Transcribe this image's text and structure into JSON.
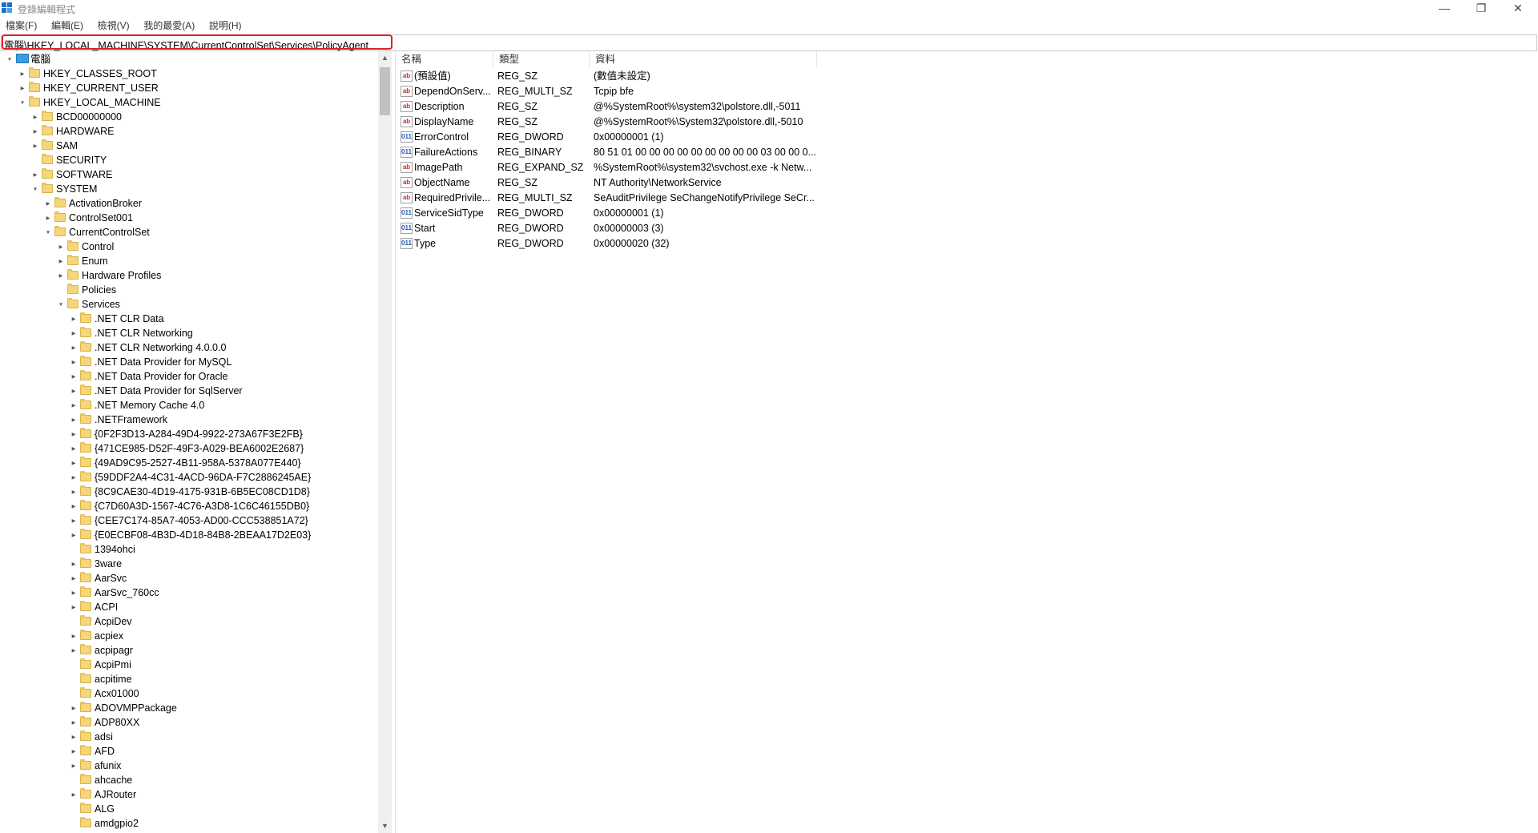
{
  "window": {
    "title": "登錄編輯程式",
    "minimize": "—",
    "maximize": "❐",
    "close": "✕"
  },
  "menu": [
    "檔案(F)",
    "編輯(E)",
    "檢視(V)",
    "我的最愛(A)",
    "說明(H)"
  ],
  "address": "電腦\\HKEY_LOCAL_MACHINE\\SYSTEM\\CurrentControlSet\\Services\\PolicyAgent",
  "tree": [
    {
      "label": "電腦",
      "level": 0,
      "state": "open",
      "icon": "computer-icon"
    },
    {
      "label": "HKEY_CLASSES_ROOT",
      "level": 1,
      "state": "closed"
    },
    {
      "label": "HKEY_CURRENT_USER",
      "level": 1,
      "state": "closed"
    },
    {
      "label": "HKEY_LOCAL_MACHINE",
      "level": 1,
      "state": "open"
    },
    {
      "label": "BCD00000000",
      "level": 2,
      "state": "closed"
    },
    {
      "label": "HARDWARE",
      "level": 2,
      "state": "closed"
    },
    {
      "label": "SAM",
      "level": 2,
      "state": "closed"
    },
    {
      "label": "SECURITY",
      "level": 2,
      "state": "none"
    },
    {
      "label": "SOFTWARE",
      "level": 2,
      "state": "closed"
    },
    {
      "label": "SYSTEM",
      "level": 2,
      "state": "open"
    },
    {
      "label": "ActivationBroker",
      "level": 3,
      "state": "closed"
    },
    {
      "label": "ControlSet001",
      "level": 3,
      "state": "closed"
    },
    {
      "label": "CurrentControlSet",
      "level": 3,
      "state": "open"
    },
    {
      "label": "Control",
      "level": 4,
      "state": "closed"
    },
    {
      "label": "Enum",
      "level": 4,
      "state": "closed"
    },
    {
      "label": "Hardware Profiles",
      "level": 4,
      "state": "closed"
    },
    {
      "label": "Policies",
      "level": 4,
      "state": "none"
    },
    {
      "label": "Services",
      "level": 4,
      "state": "open"
    },
    {
      "label": ".NET CLR Data",
      "level": 5,
      "state": "closed"
    },
    {
      "label": ".NET CLR Networking",
      "level": 5,
      "state": "closed"
    },
    {
      "label": ".NET CLR Networking 4.0.0.0",
      "level": 5,
      "state": "closed"
    },
    {
      "label": ".NET Data Provider for MySQL",
      "level": 5,
      "state": "closed"
    },
    {
      "label": ".NET Data Provider for Oracle",
      "level": 5,
      "state": "closed"
    },
    {
      "label": ".NET Data Provider for SqlServer",
      "level": 5,
      "state": "closed"
    },
    {
      "label": ".NET Memory Cache 4.0",
      "level": 5,
      "state": "closed"
    },
    {
      "label": ".NETFramework",
      "level": 5,
      "state": "closed"
    },
    {
      "label": "{0F2F3D13-A284-49D4-9922-273A67F3E2FB}",
      "level": 5,
      "state": "closed"
    },
    {
      "label": "{471CE985-D52F-49F3-A029-BEA6002E2687}",
      "level": 5,
      "state": "closed"
    },
    {
      "label": "{49AD9C95-2527-4B11-958A-5378A077E440}",
      "level": 5,
      "state": "closed"
    },
    {
      "label": "{59DDF2A4-4C31-4ACD-96DA-F7C2886245AE}",
      "level": 5,
      "state": "closed"
    },
    {
      "label": "{8C9CAE30-4D19-4175-931B-6B5EC08CD1D8}",
      "level": 5,
      "state": "closed"
    },
    {
      "label": "{C7D60A3D-1567-4C76-A3D8-1C6C46155DB0}",
      "level": 5,
      "state": "closed"
    },
    {
      "label": "{CEE7C174-85A7-4053-AD00-CCC538851A72}",
      "level": 5,
      "state": "closed"
    },
    {
      "label": "{E0ECBF08-4B3D-4D18-84B8-2BEAA17D2E03}",
      "level": 5,
      "state": "closed"
    },
    {
      "label": "1394ohci",
      "level": 5,
      "state": "none"
    },
    {
      "label": "3ware",
      "level": 5,
      "state": "closed"
    },
    {
      "label": "AarSvc",
      "level": 5,
      "state": "closed"
    },
    {
      "label": "AarSvc_760cc",
      "level": 5,
      "state": "closed"
    },
    {
      "label": "ACPI",
      "level": 5,
      "state": "closed"
    },
    {
      "label": "AcpiDev",
      "level": 5,
      "state": "none"
    },
    {
      "label": "acpiex",
      "level": 5,
      "state": "closed"
    },
    {
      "label": "acpipagr",
      "level": 5,
      "state": "closed"
    },
    {
      "label": "AcpiPmi",
      "level": 5,
      "state": "none"
    },
    {
      "label": "acpitime",
      "level": 5,
      "state": "none"
    },
    {
      "label": "Acx01000",
      "level": 5,
      "state": "none"
    },
    {
      "label": "ADOVMPPackage",
      "level": 5,
      "state": "closed"
    },
    {
      "label": "ADP80XX",
      "level": 5,
      "state": "closed"
    },
    {
      "label": "adsi",
      "level": 5,
      "state": "closed"
    },
    {
      "label": "AFD",
      "level": 5,
      "state": "closed"
    },
    {
      "label": "afunix",
      "level": 5,
      "state": "closed"
    },
    {
      "label": "ahcache",
      "level": 5,
      "state": "none"
    },
    {
      "label": "AJRouter",
      "level": 5,
      "state": "closed"
    },
    {
      "label": "ALG",
      "level": 5,
      "state": "none"
    },
    {
      "label": "amdgpio2",
      "level": 5,
      "state": "none"
    }
  ],
  "list": {
    "headers": {
      "name": "名稱",
      "type": "類型",
      "data": "資料"
    },
    "rows": [
      {
        "icon": "ab",
        "name": "(預設值)",
        "type": "REG_SZ",
        "data": "(數值未設定)"
      },
      {
        "icon": "ab",
        "name": "DependOnServ...",
        "type": "REG_MULTI_SZ",
        "data": "Tcpip bfe"
      },
      {
        "icon": "ab",
        "name": "Description",
        "type": "REG_SZ",
        "data": "@%SystemRoot%\\system32\\polstore.dll,-5011"
      },
      {
        "icon": "ab",
        "name": "DisplayName",
        "type": "REG_SZ",
        "data": "@%SystemRoot%\\System32\\polstore.dll,-5010"
      },
      {
        "icon": "bin",
        "name": "ErrorControl",
        "type": "REG_DWORD",
        "data": "0x00000001 (1)"
      },
      {
        "icon": "bin",
        "name": "FailureActions",
        "type": "REG_BINARY",
        "data": "80 51 01 00 00 00 00 00 00 00 00 00 03 00 00 0..."
      },
      {
        "icon": "ab",
        "name": "ImagePath",
        "type": "REG_EXPAND_SZ",
        "data": "%SystemRoot%\\system32\\svchost.exe -k Netw..."
      },
      {
        "icon": "ab",
        "name": "ObjectName",
        "type": "REG_SZ",
        "data": "NT Authority\\NetworkService"
      },
      {
        "icon": "ab",
        "name": "RequiredPrivile...",
        "type": "REG_MULTI_SZ",
        "data": "SeAuditPrivilege SeChangeNotifyPrivilege SeCr..."
      },
      {
        "icon": "bin",
        "name": "ServiceSidType",
        "type": "REG_DWORD",
        "data": "0x00000001 (1)"
      },
      {
        "icon": "bin",
        "name": "Start",
        "type": "REG_DWORD",
        "data": "0x00000003 (3)"
      },
      {
        "icon": "bin",
        "name": "Type",
        "type": "REG_DWORD",
        "data": "0x00000020 (32)"
      }
    ]
  },
  "icons": {
    "ab": "ab",
    "bin": "011"
  }
}
